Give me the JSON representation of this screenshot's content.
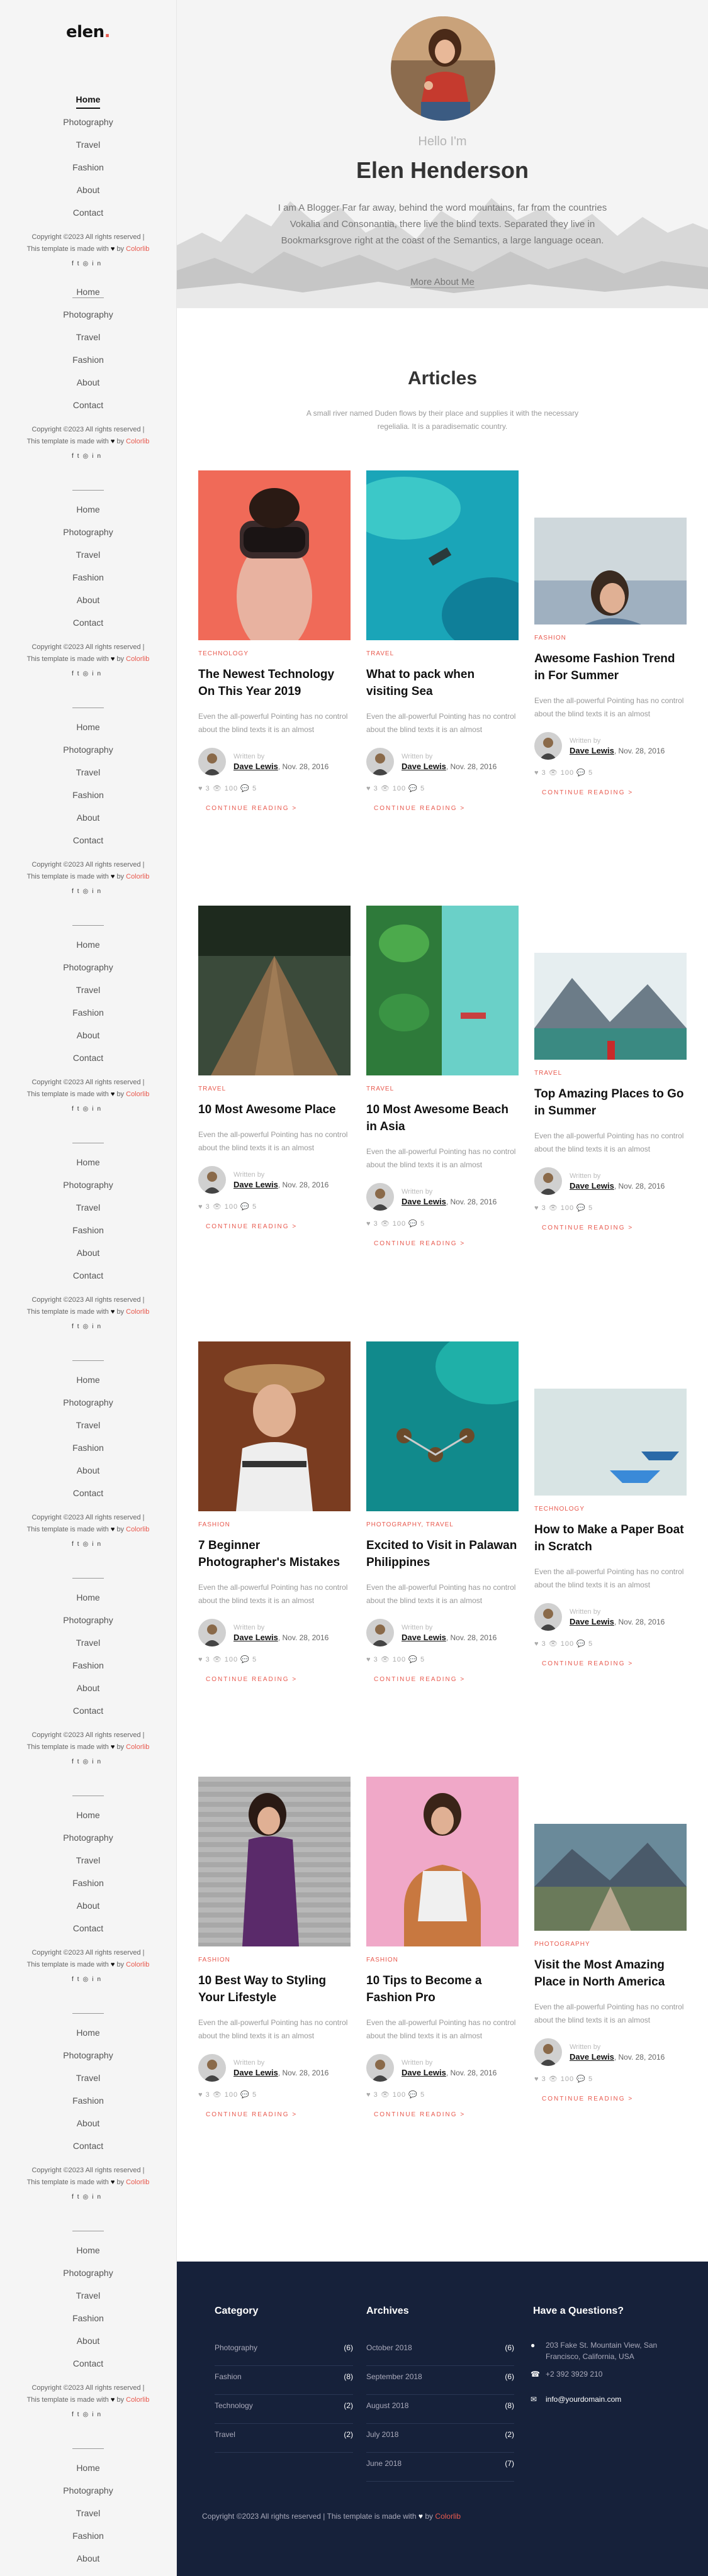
{
  "sidebar": {
    "logo": "elen",
    "logo_dot": ".",
    "nav": [
      "Home",
      "Photography",
      "Travel",
      "Fashion",
      "About",
      "Contact"
    ],
    "copyright_a": "Copyright ©2023 All rights reserved | This template is made with",
    "copyright_b": "by",
    "colorlib": "Colorlib"
  },
  "hero": {
    "hello": "Hello I'm",
    "name": "Elen Henderson",
    "bio": "I am A Blogger Far far away, behind the word mountains, far from the countries Vokalia and Consonantia, there live the blind texts. Separated they live in Bookmarksgrove right at the coast of the Semantics, a large language ocean.",
    "link": "More About Me"
  },
  "articles": {
    "heading": "Articles",
    "subheading": "A small river named Duden flows by their place and supplies it with the necessary regelialia. It is a paradisematic country.",
    "written_by": "Written by",
    "excerpt": "Even the all-powerful Pointing has no control about the blind texts it is an almost",
    "more": "CONTINUE READING >",
    "stats": "♥ 3   👁 100   💬 5",
    "cards": [
      {
        "cat": "TECHNOLOGY",
        "title": "The Newest Technology On This Year 2019",
        "author": "Dave Lewis",
        "date": ", Nov. 28, 2016"
      },
      {
        "cat": "TRAVEL",
        "title": "What to pack when visiting Sea",
        "author": "Dave Lewis",
        "date": ", Nov. 28, 2016"
      },
      {
        "cat": "FASHION",
        "title": "Awesome Fashion Trend in For Summer",
        "author": "Dave Lewis",
        "date": ", Nov. 28, 2016"
      },
      {
        "cat": "TRAVEL",
        "title": "10 Most Awesome Place",
        "author": "Dave Lewis",
        "date": ", Nov. 28, 2016"
      },
      {
        "cat": "TRAVEL",
        "title": "10 Most Awesome Beach in Asia",
        "author": "Dave Lewis",
        "date": ", Nov. 28, 2016"
      },
      {
        "cat": "TRAVEL",
        "title": "Top Amazing Places to Go in Summer",
        "author": "Dave Lewis",
        "date": ", Nov. 28, 2016"
      },
      {
        "cat": "FASHION",
        "title": "7 Beginner Photographer's Mistakes",
        "author": "Dave Lewis",
        "date": ", Nov. 28, 2016"
      },
      {
        "cat": "PHOTOGRAPHY, TRAVEL",
        "title": "Excited to Visit in Palawan Philippines",
        "author": "Dave Lewis",
        "date": ", Nov. 28, 2016"
      },
      {
        "cat": "TECHNOLOGY",
        "title": "How to Make a Paper Boat in Scratch",
        "author": "Dave Lewis",
        "date": ", Nov. 28, 2016"
      },
      {
        "cat": "FASHION",
        "title": "10 Best Way to Styling Your Lifestyle",
        "author": "Dave Lewis",
        "date": ", Nov. 28, 2016"
      },
      {
        "cat": "FASHION",
        "title": "10 Tips to Become a Fashion Pro",
        "author": "Dave Lewis",
        "date": ", Nov. 28, 2016"
      },
      {
        "cat": "PHOTOGRAPHY",
        "title": "Visit the Most Amazing Place in North America",
        "author": "Dave Lewis",
        "date": ", Nov. 28, 2016"
      }
    ]
  },
  "footer": {
    "category_heading": "Category",
    "categories": [
      {
        "label": "Photography",
        "count": "(6)"
      },
      {
        "label": "Fashion",
        "count": "(8)"
      },
      {
        "label": "Technology",
        "count": "(2)"
      },
      {
        "label": "Travel",
        "count": "(2)"
      }
    ],
    "archives_heading": "Archives",
    "archives": [
      {
        "label": "October 2018",
        "count": "(6)"
      },
      {
        "label": "September 2018",
        "count": "(6)"
      },
      {
        "label": "August 2018",
        "count": "(8)"
      },
      {
        "label": "July 2018",
        "count": "(2)"
      },
      {
        "label": "June 2018",
        "count": "(7)"
      }
    ],
    "contact_heading": "Have a Questions?",
    "address": "203 Fake St. Mountain View, San Francisco, California, USA",
    "phone": "+2 392 3929 210",
    "email": "info@yourdomain.com",
    "copyright_a": "Copyright ©2023 All rights reserved | This template is made with",
    "copyright_b": "by",
    "colorlib": "Colorlib"
  },
  "colors": {
    "accent": "#e85a4f",
    "footer_bg": "#16213a",
    "sidebar_bg": "#f5f5f5"
  }
}
